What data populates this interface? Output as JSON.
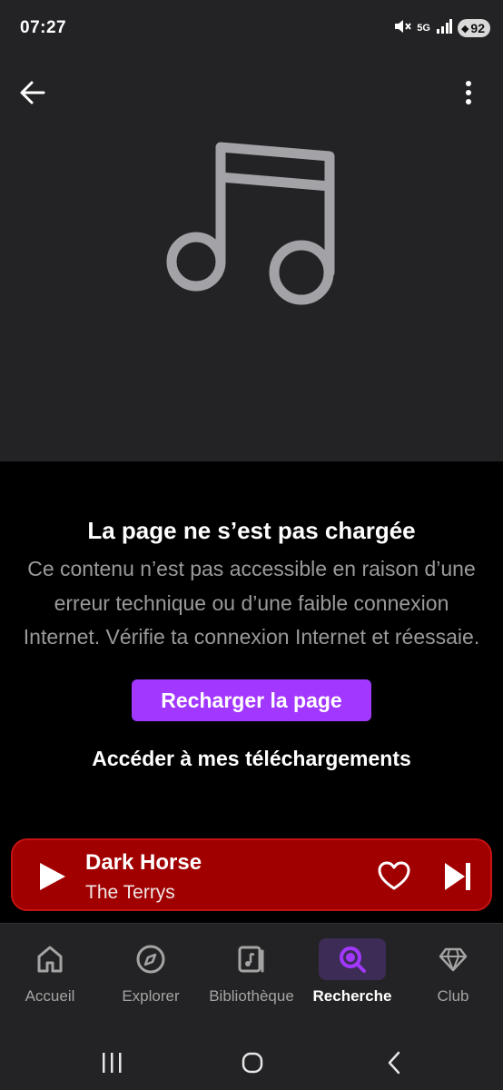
{
  "status": {
    "time": "07:27",
    "network": "5G",
    "battery": "92"
  },
  "icons": {
    "back": "arrow-left-icon",
    "more": "more-vertical-icon",
    "artwork": "music-note-icon",
    "play": "play-icon",
    "like": "heart-icon",
    "next": "skip-next-icon"
  },
  "error": {
    "title": "La page ne s’est pas chargée",
    "body": "Ce contenu n’est pas accessible en raison d’une erreur technique ou d’une faible connexion Internet. Vérifie ta connexion Internet et réessaie.",
    "reload_label": "Recharger la page",
    "downloads_label": "Accéder à mes téléchargements"
  },
  "player": {
    "title": "Dark Horse",
    "artist": "The Terrys"
  },
  "nav": {
    "items": [
      {
        "label": "Accueil",
        "icon": "home-icon",
        "active": false
      },
      {
        "label": "Explorer",
        "icon": "compass-icon",
        "active": false
      },
      {
        "label": "Bibliothèque",
        "icon": "library-icon",
        "active": false
      },
      {
        "label": "Recherche",
        "icon": "search-icon",
        "active": true
      },
      {
        "label": "Club",
        "icon": "diamond-icon",
        "active": false
      }
    ]
  },
  "colors": {
    "accent": "#a238ff",
    "player_bg": "#a10000",
    "surface": "#232325",
    "background": "#000000",
    "muted_text": "#9a9a9a"
  }
}
